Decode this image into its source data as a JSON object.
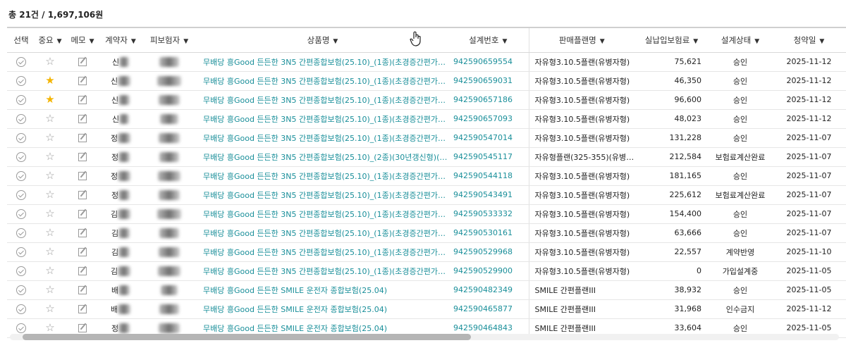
{
  "summary": "총 21건 / 1,697,106원",
  "columns": {
    "select": "선택",
    "important": "중요",
    "memo": "메모",
    "contractor": "계약자",
    "insured": "피보험자",
    "product": "상품명",
    "design_no": "설계번호",
    "sales_plan": "판매플랜명",
    "premium": "실납입보험료",
    "status": "설계상태",
    "contract_date": "청약일"
  },
  "rows": [
    {
      "starred": false,
      "contractor_initial": "신",
      "product": "무배당 흥Good 든든한 3N5 간편종합보험(25.10)_(1종)(초경증간편가입…",
      "design_no": "942590659554",
      "plan": "자유형3.10.5플랜(유병자형)",
      "premium": "75,621",
      "status": "승인",
      "date": "2025-11-12"
    },
    {
      "starred": true,
      "contractor_initial": "신",
      "product": "무배당 흥Good 든든한 3N5 간편종합보험(25.10)_(1종)(초경증간편가입…",
      "design_no": "942590659031",
      "plan": "자유형3.10.5플랜(유병자형)",
      "premium": "46,350",
      "status": "승인",
      "date": "2025-11-12"
    },
    {
      "starred": true,
      "contractor_initial": "신",
      "product": "무배당 흥Good 든든한 3N5 간편종합보험(25.10)_(1종)(초경증간편가입…",
      "design_no": "942590657186",
      "plan": "자유형3.10.5플랜(유병자형)",
      "premium": "96,600",
      "status": "승인",
      "date": "2025-11-12"
    },
    {
      "starred": false,
      "contractor_initial": "신",
      "product": "무배당 흥Good 든든한 3N5 간편종합보험(25.10)_(1종)(초경증간편가입…",
      "design_no": "942590657093",
      "plan": "자유형3.10.5플랜(유병자형)",
      "premium": "48,023",
      "status": "승인",
      "date": "2025-11-12"
    },
    {
      "starred": false,
      "contractor_initial": "정",
      "product": "무배당 흥Good 든든한 3N5 간편종합보험(25.10)_(1종)(초경증간편가입…",
      "design_no": "942590547014",
      "plan": "자유형3.10.5플랜(유병자형)",
      "premium": "131,228",
      "status": "승인",
      "date": "2025-11-07"
    },
    {
      "starred": false,
      "contractor_initial": "정",
      "product": "무배당 흥Good 든든한 3N5 간편종합보험(25.10)_(2종)(30년갱신형)(통…",
      "design_no": "942590545117",
      "plan": "자유형플랜(325-355)(유병자형)",
      "premium": "212,584",
      "status": "보험료계산완료",
      "date": "2025-11-07"
    },
    {
      "starred": false,
      "contractor_initial": "정",
      "product": "무배당 흥Good 든든한 3N5 간편종합보험(25.10)_(1종)(초경증간편가입…",
      "design_no": "942590544118",
      "plan": "자유형3.10.5플랜(유병자형)",
      "premium": "181,165",
      "status": "승인",
      "date": "2025-11-07"
    },
    {
      "starred": false,
      "contractor_initial": "정",
      "product": "무배당 흥Good 든든한 3N5 간편종합보험(25.10)_(1종)(초경증간편가입…",
      "design_no": "942590543491",
      "plan": "자유형3.10.5플랜(유병자형)",
      "premium": "225,612",
      "status": "보험료계산완료",
      "date": "2025-11-07"
    },
    {
      "starred": false,
      "contractor_initial": "김",
      "product": "무배당 흥Good 든든한 3N5 간편종합보험(25.10)_(1종)(초경증간편가입…",
      "design_no": "942590533332",
      "plan": "자유형3.10.5플랜(유병자형)",
      "premium": "154,400",
      "status": "승인",
      "date": "2025-11-07"
    },
    {
      "starred": false,
      "contractor_initial": "김",
      "product": "무배당 흥Good 든든한 3N5 간편종합보험(25.10)_(1종)(초경증간편가입…",
      "design_no": "942590530161",
      "plan": "자유형3.10.5플랜(유병자형)",
      "premium": "63,666",
      "status": "승인",
      "date": "2025-11-07"
    },
    {
      "starred": false,
      "contractor_initial": "김",
      "product": "무배당 흥Good 든든한 3N5 간편종합보험(25.10)_(1종)(초경증간편가입…",
      "design_no": "942590529968",
      "plan": "자유형3.10.5플랜(유병자형)",
      "premium": "22,557",
      "status": "계약반영",
      "date": "2025-11-10"
    },
    {
      "starred": false,
      "contractor_initial": "김",
      "product": "무배당 흥Good 든든한 3N5 간편종합보험(25.10)_(1종)(초경증간편가입…",
      "design_no": "942590529900",
      "plan": "자유형3.10.5플랜(유병자형)",
      "premium": "0",
      "status": "가입설계중",
      "date": "2025-11-05"
    },
    {
      "starred": false,
      "contractor_initial": "배",
      "product": "무배당 흥Good 든든한 SMILE 운전자 종합보험(25.04)",
      "design_no": "942590482349",
      "plan": "SMILE 간편플랜III",
      "premium": "38,932",
      "status": "승인",
      "date": "2025-11-05"
    },
    {
      "starred": false,
      "contractor_initial": "배",
      "product": "무배당 흥Good 든든한 SMILE 운전자 종합보험(25.04)",
      "design_no": "942590465877",
      "plan": "SMILE 간편플랜III",
      "premium": "31,968",
      "status": "인수금지",
      "date": "2025-11-12"
    },
    {
      "starred": false,
      "contractor_initial": "정",
      "product": "무배당 흥Good 든든한 SMILE 운전자 종합보험(25.04)",
      "design_no": "942590464843",
      "plan": "SMILE 간편플랜III",
      "premium": "33,604",
      "status": "승인",
      "date": "2025-11-05"
    }
  ],
  "icons": {
    "chevron": "chevron-down-icon",
    "check": "check-circle-icon",
    "star": "star-icon",
    "memo": "edit-icon",
    "cursor": "hand-cursor-icon"
  },
  "colors": {
    "link": "#1a8f9a",
    "star_on": "#f4b400",
    "icon_gray": "#9a9a9a"
  }
}
